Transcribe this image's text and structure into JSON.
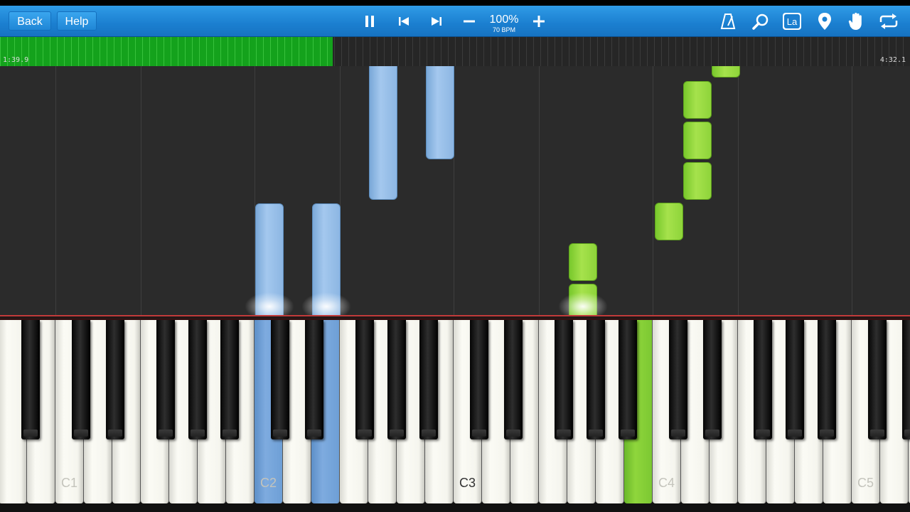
{
  "toolbar": {
    "back_label": "Back",
    "help_label": "Help",
    "speed_percent": "100%",
    "speed_bpm": "70 BPM",
    "icons": [
      "pause-icon",
      "skip-back-icon",
      "skip-forward-icon",
      "minus-icon",
      "plus-icon",
      "metronome-icon",
      "search-icon",
      "language-icon",
      "map-pin-icon",
      "hand-icon",
      "loop-icon"
    ],
    "language_glyph": "La"
  },
  "progress": {
    "elapsed": "1:39.9",
    "total": "4:32.1",
    "fraction": 0.366
  },
  "keyboard": {
    "labels": [
      "C1",
      "C2",
      "C3",
      "C4",
      "C5"
    ],
    "pressed_blue_keys": [
      "C2",
      "E2"
    ],
    "pressed_green_keys": [
      "B3"
    ]
  },
  "colors": {
    "toolbar": "#1b7fd0",
    "left_hand_notes": "#8cb6e3",
    "right_hand_notes": "#8ed43a",
    "progress_fill": "#14a21c"
  }
}
